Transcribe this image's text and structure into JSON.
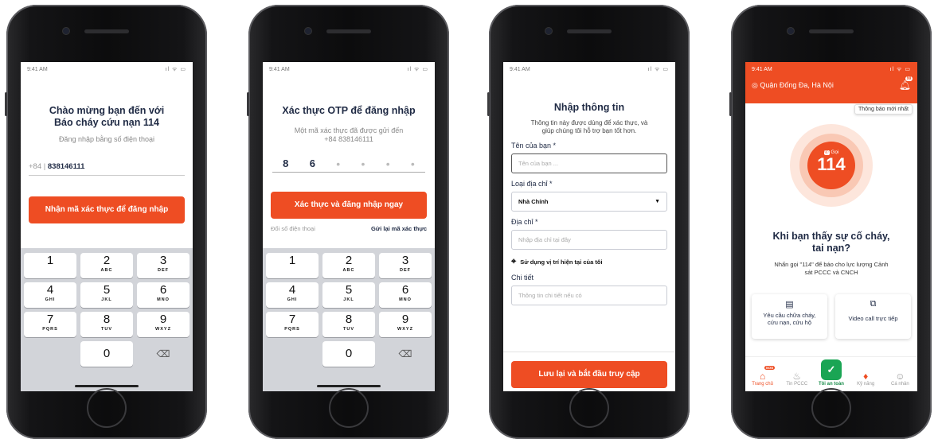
{
  "status_time": "9:41 AM",
  "status_icons": "ıl ᯤ ▭",
  "screen1": {
    "title_line1": "Chào mừng bạn đến với",
    "title_line2": "Báo cháy cứu nạn 114",
    "subtitle": "Đăng nhập bằng số điện thoại",
    "phone_prefix": "+84 |",
    "phone_number": "838146111",
    "button": "Nhận mã xác thực để đăng nhập"
  },
  "screen2": {
    "title": "Xác thực OTP để đăng nhập",
    "subtitle_line1": "Một mã xác thực đã được gửi đến",
    "subtitle_line2": "+84 838146111",
    "otp": [
      "8",
      "6",
      "•",
      "•",
      "•",
      "•"
    ],
    "button": "Xác thực và đăng nhập ngay",
    "change_phone": "Đổi số điện thoại",
    "resend": "Gửi lại mã xác thực"
  },
  "keypad": [
    {
      "d": "1",
      "l": ""
    },
    {
      "d": "2",
      "l": "ABC"
    },
    {
      "d": "3",
      "l": "DEF"
    },
    {
      "d": "4",
      "l": "GHI"
    },
    {
      "d": "5",
      "l": "JKL"
    },
    {
      "d": "6",
      "l": "MNO"
    },
    {
      "d": "7",
      "l": "PQRS"
    },
    {
      "d": "8",
      "l": "TUV"
    },
    {
      "d": "9",
      "l": "WXYZ"
    }
  ],
  "keypad_zero": "0",
  "keypad_delete_icon": "⌫",
  "screen3": {
    "title": "Nhập thông tin",
    "desc_line1": "Thông tin này được dùng để xác thực, và",
    "desc_line2": "giúp chúng tôi hỗ trợ bạn tốt hơn.",
    "name_label": "Tên của bạn *",
    "name_placeholder": "Tên của bạn ...",
    "addr_type_label": "Loại địa chỉ *",
    "addr_type_value": "Nhà Chính",
    "addr_label": "Địa chỉ *",
    "addr_placeholder": "Nhập địa chỉ tại đây",
    "use_location": "Sử dụng vị trí hiện tại của tôi",
    "detail_label": "Chi tiết",
    "detail_placeholder": "Thông tin chi tiết nếu có",
    "button": "Lưu lại và bắt đầu truy cập"
  },
  "screen4": {
    "location": "Quận Đống Đa, Hà Nội",
    "bell_badge": "99",
    "tooltip": "Thông báo mới nhất",
    "call_label": "Gọi",
    "call_number": "114",
    "heading_line1": "Khi bạn thấy sự cố cháy,",
    "heading_line2": "tai nạn?",
    "desc_line1": "Nhấn gọi \"114\" để báo cho lực lượng Cảnh",
    "desc_line2": "sát PCCC và CNCH",
    "card1_line1": "Yêu cầu chữa cháy,",
    "card1_line2": "cứu nạn, cứu hộ",
    "card2": "Video call trực tiếp",
    "sos_badge": "SOS",
    "tabs": [
      "Trang chủ",
      "Tin PCCC",
      "Tôi an toàn",
      "Kỹ năng",
      "Cá nhân"
    ]
  },
  "colors": {
    "accent": "#ee4d23",
    "navy": "#1f2a44",
    "green": "#1aa554"
  }
}
